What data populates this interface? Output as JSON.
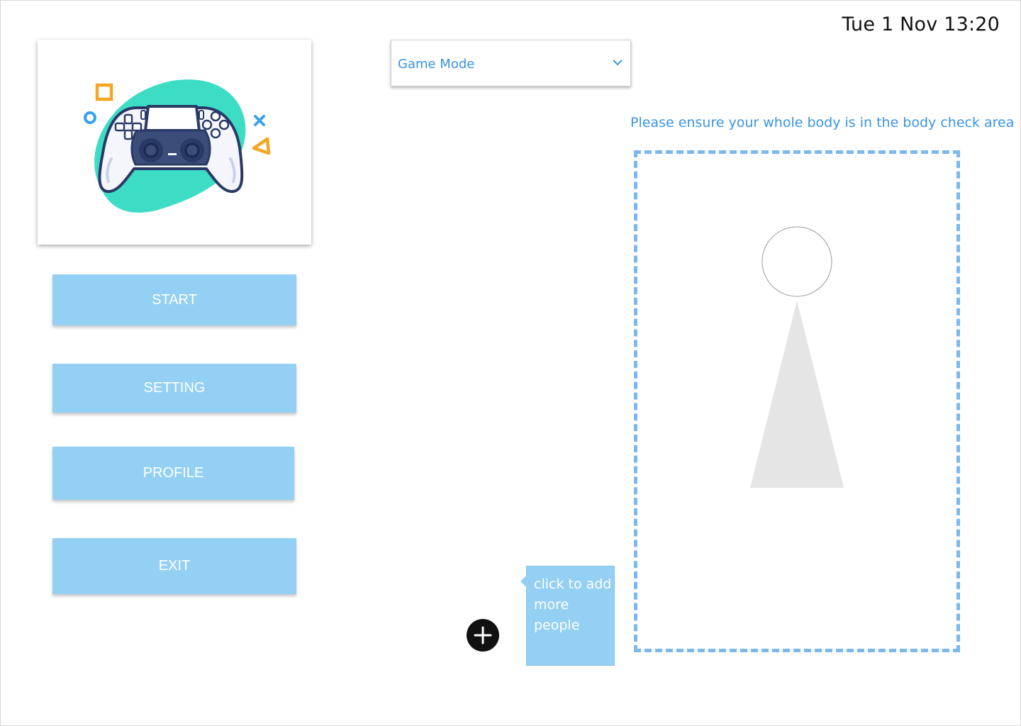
{
  "clock": {
    "text": "Tue 1 Nov 13:20"
  },
  "menu": {
    "start": "START",
    "setting": "SETTING",
    "profile": "PROFILE",
    "exit": "EXIT"
  },
  "mode_select": {
    "selected": "Game Mode",
    "icon": "chevron-down-icon"
  },
  "body_check": {
    "hint": "Please ensure your whole body is in the body check area",
    "silhouette": "person-silhouette"
  },
  "add_people": {
    "icon": "plus-icon",
    "tooltip": "click to add more people"
  },
  "logo": {
    "icon": "game-controller-icon"
  },
  "colors": {
    "button_bg": "#94d0f3",
    "accent_text": "#3a94e0",
    "dashed_border": "#7bb8ef",
    "controller_blob": "#3ddcc4",
    "shape_orange": "#f5a623",
    "shape_blue": "#3aa0e8",
    "silhouette_gray": "#e5e5e5"
  }
}
